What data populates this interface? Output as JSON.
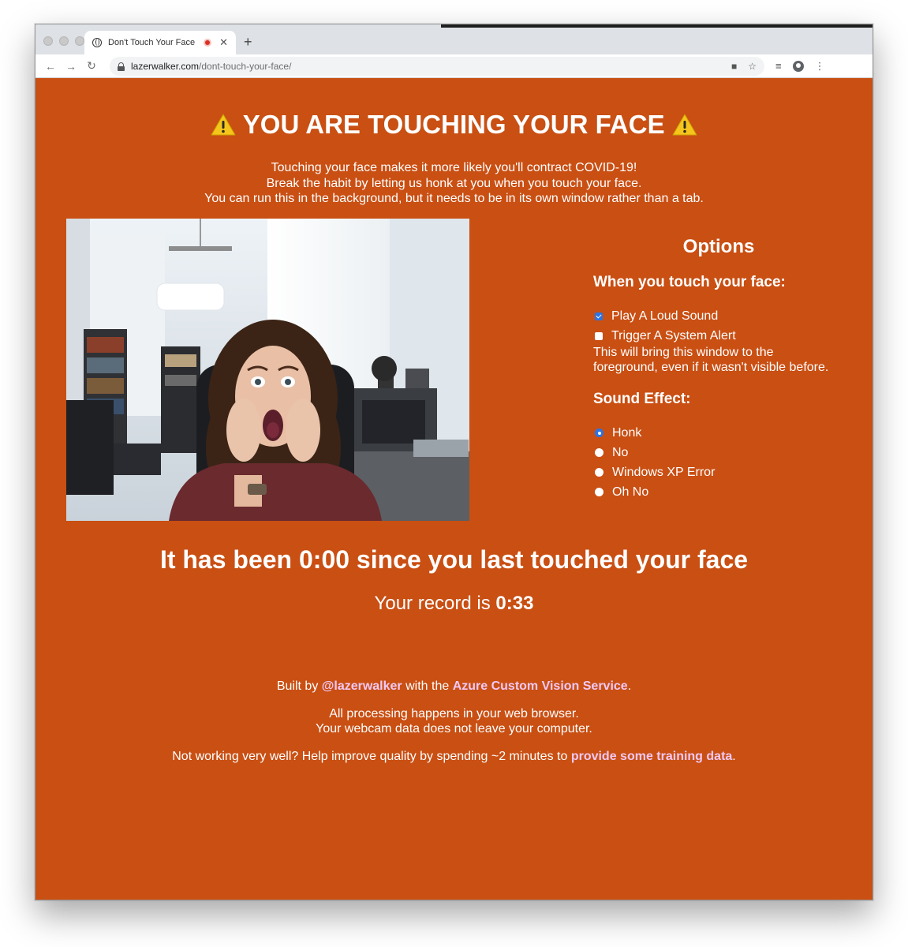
{
  "browser": {
    "tab_title": "Don't Touch Your Face",
    "new_tab_symbol": "+",
    "close_symbol": "✕",
    "url_domain": "lazerwalker.com",
    "url_path": "/dont-touch-your-face/"
  },
  "page": {
    "headline": "YOU ARE TOUCHING YOUR FACE",
    "intro_lines": [
      "Touching your face makes it more likely you'll contract COVID-19!",
      "Break the habit by letting us honk at you when you touch your face.",
      "You can run this in the background, but it needs to be in its own window rather than a tab."
    ],
    "options": {
      "title": "Options",
      "touch_heading": "When you touch your face:",
      "touch_options": [
        {
          "label": "Play A Loud Sound",
          "checked": true
        },
        {
          "label": "Trigger A System Alert",
          "checked": false
        }
      ],
      "alert_note_lines": [
        "This will bring this window to the",
        "foreground, even if it wasn't visible before."
      ],
      "sound_heading": "Sound Effect:",
      "sound_options": [
        {
          "label": "Honk",
          "selected": true
        },
        {
          "label": "No",
          "selected": false
        },
        {
          "label": "Windows XP Error",
          "selected": false
        },
        {
          "label": "Oh No",
          "selected": false
        }
      ]
    },
    "timer_text": "It has been 0:00 since you last touched your face",
    "record_prefix": "Your record is ",
    "record_value": "0:33",
    "footer": {
      "built_by": "Built by ",
      "author_link": "@lazerwalker",
      "with_the": " with the ",
      "service_link": "Azure Custom Vision Service",
      "period": ".",
      "privacy_lines": [
        "All processing happens in your web browser.",
        "Your webcam data does not leave your computer."
      ],
      "help_text": "Not working very well? Help improve quality by spending ~2 minutes to ",
      "help_link": "provide some training data",
      "help_end": "."
    }
  },
  "colors": {
    "page_background": "#c94f13",
    "link": "#f2c9f5",
    "accent": "#2b74e4"
  }
}
